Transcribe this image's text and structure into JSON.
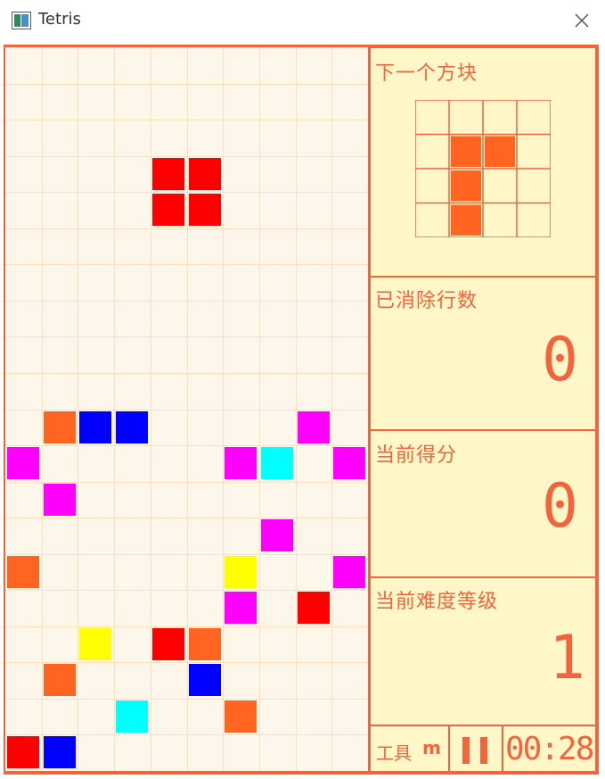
{
  "window": {
    "title": "Tetris"
  },
  "colors": {
    "accent": "#f4643c",
    "panel_bg": "#fff7c8",
    "board_bg": "#fdf6ea",
    "grid_line": "#ffe0b8",
    "red": "#ff0000",
    "orange": "#ff6420",
    "blue": "#0000ff",
    "magenta": "#ff00ff",
    "cyan": "#00ffff",
    "yellow": "#ffff00"
  },
  "board": {
    "columns": 10,
    "rows": 20,
    "current_piece": {
      "shape": "O",
      "color": "red",
      "cells": [
        [
          4,
          3
        ],
        [
          5,
          3
        ],
        [
          4,
          4
        ],
        [
          5,
          4
        ]
      ]
    },
    "settled_cells": [
      [
        1,
        10,
        "orange"
      ],
      [
        2,
        10,
        "blue"
      ],
      [
        3,
        10,
        "blue"
      ],
      [
        8,
        10,
        "magenta"
      ],
      [
        0,
        11,
        "magenta"
      ],
      [
        6,
        11,
        "magenta"
      ],
      [
        7,
        11,
        "cyan"
      ],
      [
        9,
        11,
        "magenta"
      ],
      [
        1,
        12,
        "magenta"
      ],
      [
        7,
        13,
        "magenta"
      ],
      [
        0,
        14,
        "orange"
      ],
      [
        6,
        14,
        "yellow"
      ],
      [
        9,
        14,
        "magenta"
      ],
      [
        6,
        15,
        "magenta"
      ],
      [
        8,
        15,
        "red"
      ],
      [
        2,
        16,
        "yellow"
      ],
      [
        4,
        16,
        "red"
      ],
      [
        5,
        16,
        "orange"
      ],
      [
        1,
        17,
        "orange"
      ],
      [
        5,
        17,
        "blue"
      ],
      [
        3,
        18,
        "cyan"
      ],
      [
        6,
        18,
        "orange"
      ],
      [
        0,
        19,
        "red"
      ],
      [
        1,
        19,
        "blue"
      ]
    ]
  },
  "panel": {
    "next_piece": {
      "label": "下一个方块",
      "color": "orange",
      "cells": [
        [
          1,
          1
        ],
        [
          2,
          1
        ],
        [
          1,
          2
        ],
        [
          1,
          3
        ]
      ]
    },
    "lines_cleared": {
      "label": "已消除行数",
      "value": "0"
    },
    "score": {
      "label": "当前得分",
      "value": "0"
    },
    "level": {
      "label": "当前难度等级",
      "value": "1"
    }
  },
  "toolbar": {
    "tools_label": "工具",
    "tools_key": "m",
    "timer": "00:28"
  }
}
